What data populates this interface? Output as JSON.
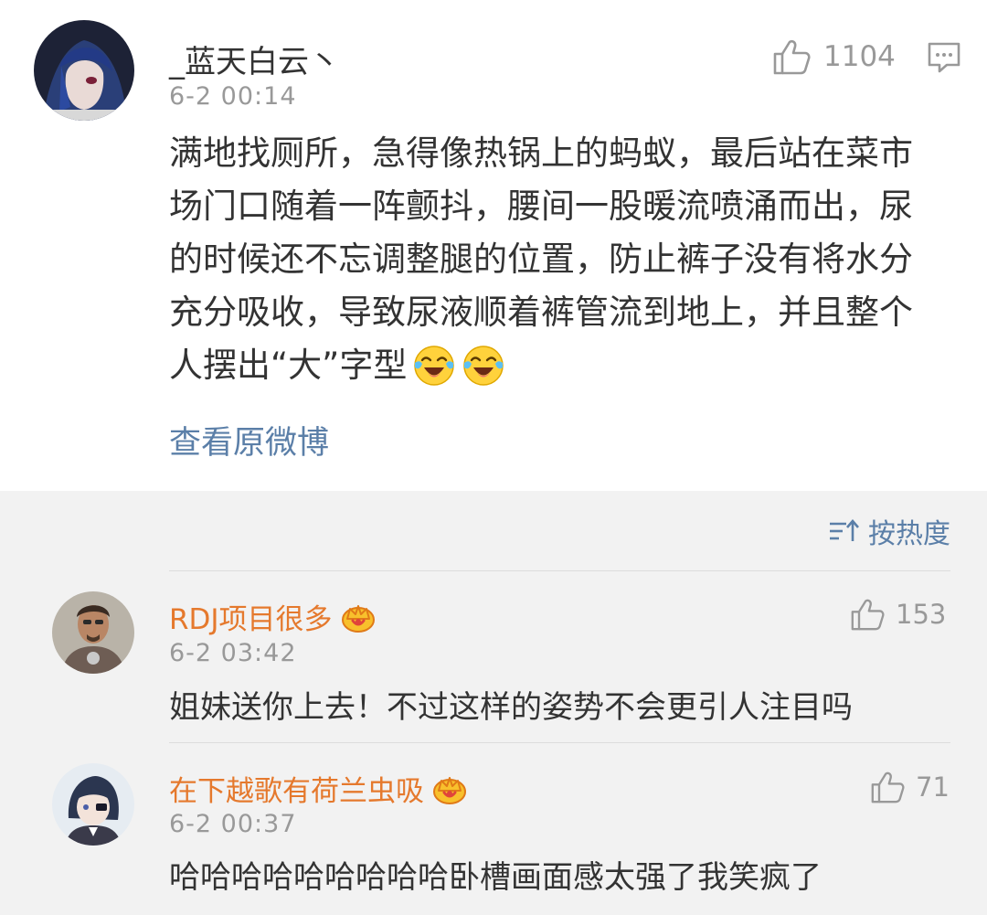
{
  "post": {
    "username": "_蓝天白云丶",
    "time": "6-2 00:14",
    "likes": "1104",
    "body_lines": [
      "满地找厕所，急得像热锅上的蚂蚁，最后站在菜市",
      "场门口随着一阵颤抖，腰间一股暖流喷涌而出，尿",
      "的时候还不忘调整腿的位置，防止裤子没有将水分",
      "充分吸收，导致尿液顺着裤管流到地上，并且整个",
      "人摆出“大”字型"
    ],
    "emoji": [
      "laugh-cry-emoji",
      "laugh-cry-emoji"
    ],
    "view_original": "查看原微博"
  },
  "sort": {
    "label": "按热度"
  },
  "comments": [
    {
      "username": "RDJ项目很多",
      "time": "6-2 03:42",
      "likes": "153",
      "text": "姐妹送你上去！不过这样的姿势不会更引人注目吗"
    },
    {
      "username": "在下越歌有荷兰虫吸",
      "time": "6-2 00:37",
      "likes": "71",
      "text": "哈哈哈哈哈哈哈哈哈卧槽画面感太强了我笑疯了"
    }
  ],
  "colors": {
    "name_orange": "#e5792d",
    "link_blue": "#5b7fa8",
    "text_dark": "#333333",
    "text_gray": "#999999"
  }
}
